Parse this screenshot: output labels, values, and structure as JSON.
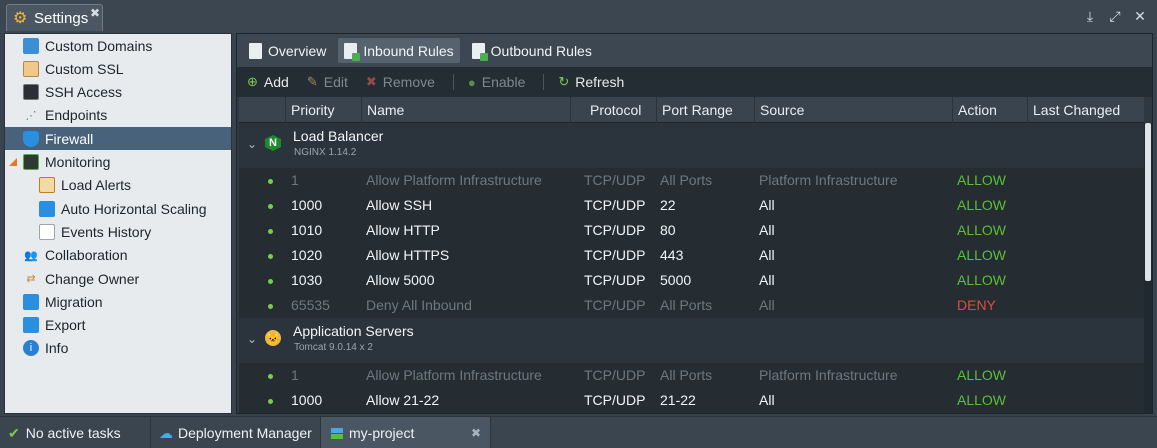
{
  "window": {
    "title": "Settings",
    "close_glyph": "✖",
    "controls": [
      "download-icon",
      "expand-icon",
      "close-icon"
    ]
  },
  "sidebar": {
    "items": [
      {
        "label": "Custom Domains",
        "icon": "globe-icon",
        "indent": 0,
        "selected": false
      },
      {
        "label": "Custom SSL",
        "icon": "certificate-icon",
        "indent": 0,
        "selected": false
      },
      {
        "label": "SSH Access",
        "icon": "terminal-icon",
        "indent": 0,
        "selected": false
      },
      {
        "label": "Endpoints",
        "icon": "endpoints-icon",
        "indent": 0,
        "selected": false
      },
      {
        "label": "Firewall",
        "icon": "shield-icon",
        "indent": 0,
        "selected": true
      },
      {
        "label": "Monitoring",
        "icon": "chart-icon",
        "indent": 0,
        "selected": false,
        "expanded": true
      },
      {
        "label": "Load Alerts",
        "icon": "mail-alert-icon",
        "indent": 1,
        "selected": false
      },
      {
        "label": "Auto Horizontal Scaling",
        "icon": "scaling-icon",
        "indent": 1,
        "selected": false
      },
      {
        "label": "Events History",
        "icon": "document-icon",
        "indent": 1,
        "selected": false
      },
      {
        "label": "Collaboration",
        "icon": "users-icon",
        "indent": 0,
        "selected": false
      },
      {
        "label": "Change Owner",
        "icon": "user-change-icon",
        "indent": 0,
        "selected": false
      },
      {
        "label": "Migration",
        "icon": "migration-icon",
        "indent": 0,
        "selected": false
      },
      {
        "label": "Export",
        "icon": "export-icon",
        "indent": 0,
        "selected": false
      },
      {
        "label": "Info",
        "icon": "info-icon",
        "indent": 0,
        "selected": false
      }
    ]
  },
  "tabs": [
    {
      "label": "Overview",
      "active": false
    },
    {
      "label": "Inbound Rules",
      "active": true
    },
    {
      "label": "Outbound Rules",
      "active": false
    }
  ],
  "toolbar": {
    "add": "Add",
    "edit": "Edit",
    "remove": "Remove",
    "enable": "Enable",
    "refresh": "Refresh"
  },
  "columns": {
    "priority": "Priority",
    "name": "Name",
    "protocol": "Protocol",
    "port_range": "Port Range",
    "source": "Source",
    "action": "Action",
    "last_changed": "Last Changed"
  },
  "groups": [
    {
      "name": "Load Balancer",
      "sub": "NGINX 1.14.2",
      "icon": "nginx-icon",
      "rules": [
        {
          "priority": "1",
          "name": "Allow Platform Infrastructure",
          "protocol": "TCP/UDP",
          "ports": "All Ports",
          "source": "Platform Infrastructure",
          "action": "ALLOW",
          "dim": true
        },
        {
          "priority": "1000",
          "name": "Allow SSH",
          "protocol": "TCP/UDP",
          "ports": "22",
          "source": "All",
          "action": "ALLOW",
          "dim": false
        },
        {
          "priority": "1010",
          "name": "Allow HTTP",
          "protocol": "TCP/UDP",
          "ports": "80",
          "source": "All",
          "action": "ALLOW",
          "dim": false
        },
        {
          "priority": "1020",
          "name": "Allow HTTPS",
          "protocol": "TCP/UDP",
          "ports": "443",
          "source": "All",
          "action": "ALLOW",
          "dim": false
        },
        {
          "priority": "1030",
          "name": "Allow 5000",
          "protocol": "TCP/UDP",
          "ports": "5000",
          "source": "All",
          "action": "ALLOW",
          "dim": false
        },
        {
          "priority": "65535",
          "name": "Deny All Inbound",
          "protocol": "TCP/UDP",
          "ports": "All Ports",
          "source": "All",
          "action": "DENY",
          "dim": true
        }
      ]
    },
    {
      "name": "Application Servers",
      "sub": "Tomcat 9.0.14 x 2",
      "icon": "tomcat-icon",
      "rules": [
        {
          "priority": "1",
          "name": "Allow Platform Infrastructure",
          "protocol": "TCP/UDP",
          "ports": "All Ports",
          "source": "Platform Infrastructure",
          "action": "ALLOW",
          "dim": true
        },
        {
          "priority": "1000",
          "name": "Allow 21-22",
          "protocol": "TCP/UDP",
          "ports": "21-22",
          "source": "All",
          "action": "ALLOW",
          "dim": false
        }
      ]
    }
  ],
  "taskbar": {
    "status": "No active tasks",
    "deployment_manager": "Deployment Manager",
    "project": "my-project",
    "close_glyph": "✖"
  },
  "colors": {
    "allow": "#5bbf37",
    "deny": "#e14b3b",
    "selected": "#48627c"
  }
}
